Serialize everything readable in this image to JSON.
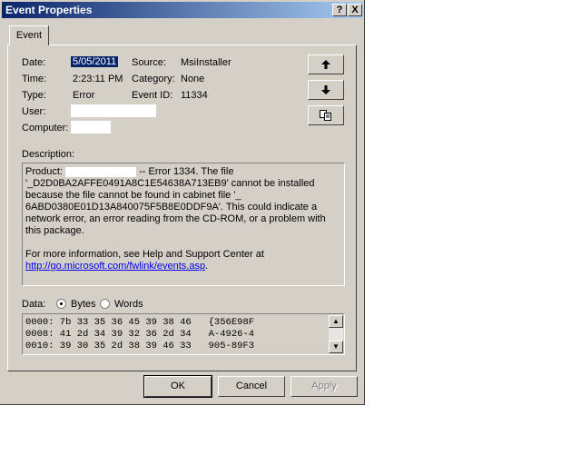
{
  "window": {
    "title": "Event Properties",
    "help_btn": "?",
    "close_btn": "X"
  },
  "tab": {
    "label": "Event"
  },
  "fields": {
    "date_label": "Date:",
    "date_value": "5/05/2011",
    "time_label": "Time:",
    "time_value": "2:23:11 PM",
    "type_label": "Type:",
    "type_value": "Error",
    "user_label": "User:",
    "computer_label": "Computer:",
    "source_label": "Source:",
    "source_value": "MsiInstaller",
    "category_label": "Category:",
    "category_value": "None",
    "eventid_label": "Event ID:",
    "eventid_value": "11334"
  },
  "side_buttons": {
    "up_icon": "arrow-up-icon",
    "down_icon": "arrow-down-icon",
    "copy_icon": "copy-icon"
  },
  "description": {
    "label": "Description:",
    "product_prefix": "Product:",
    "error_text": "-- Error 1334. The file '_D2D0BA2AFFE0491A8C1E54638A713EB9' cannot be installed because the file cannot be found in cabinet file '_ 6ABD0380E01D13A840075F5B8E0DDF9A'. This could indicate a network error, an error reading from the CD-ROM, or a problem with this package.",
    "more_info": "For more information, see Help and Support Center at",
    "link": "http://go.microsoft.com/fwlink/events.asp",
    "link_suffix": "."
  },
  "data_section": {
    "label": "Data:",
    "bytes_label": "Bytes",
    "words_label": "Words",
    "selected": "Bytes",
    "lines": [
      "0000: 7b 33 35 36 45 39 38 46   {356E98F",
      "0008: 41 2d 34 39 32 36 2d 34   A-4926-4",
      "0010: 39 30 35 2d 38 39 46 33   905-89F3"
    ]
  },
  "buttons": {
    "ok": "OK",
    "cancel": "Cancel",
    "apply": "Apply"
  }
}
